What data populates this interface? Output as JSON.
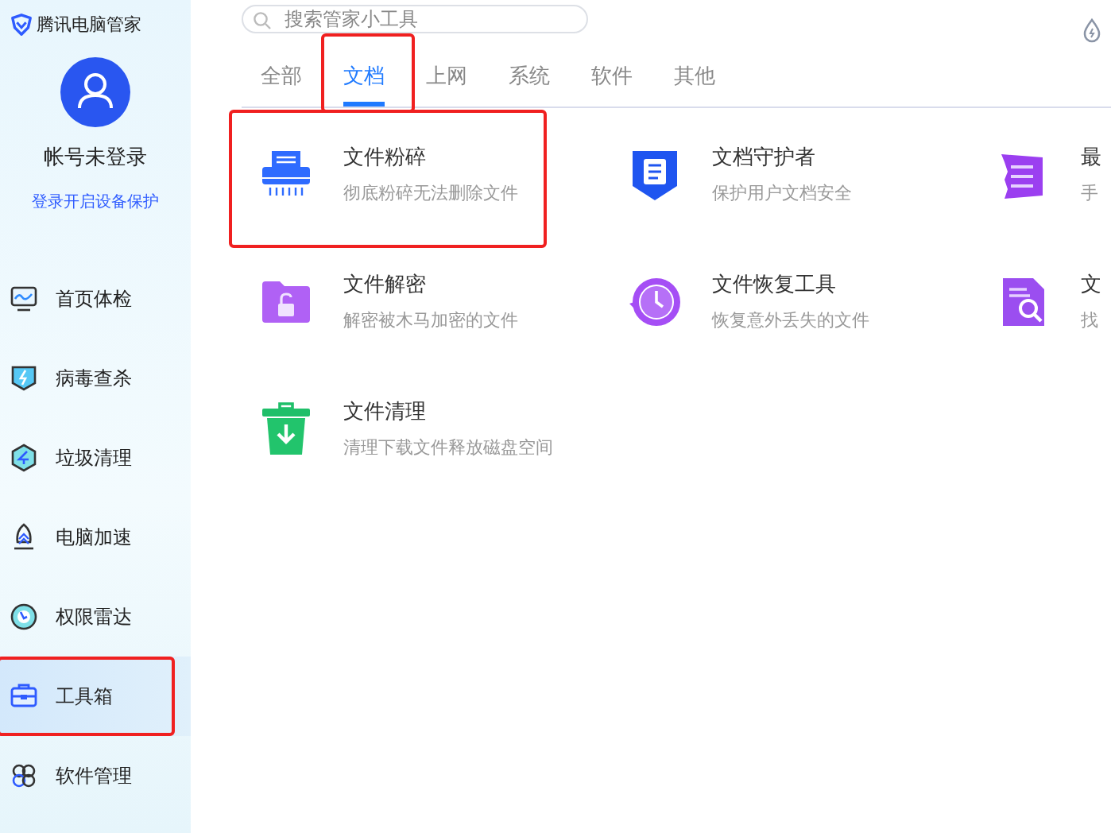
{
  "app": {
    "title": "腾讯电脑管家"
  },
  "account": {
    "name": "帐号未登录",
    "link": "登录开启设备保护"
  },
  "nav": [
    {
      "label": "首页体检",
      "selected": false,
      "highlighted": false
    },
    {
      "label": "病毒查杀",
      "selected": false,
      "highlighted": false
    },
    {
      "label": "垃圾清理",
      "selected": false,
      "highlighted": false
    },
    {
      "label": "电脑加速",
      "selected": false,
      "highlighted": false
    },
    {
      "label": "权限雷达",
      "selected": false,
      "highlighted": false
    },
    {
      "label": "工具箱",
      "selected": true,
      "highlighted": true
    },
    {
      "label": "软件管理",
      "selected": false,
      "highlighted": false
    }
  ],
  "search": {
    "placeholder": "搜索管家小工具"
  },
  "tabs": [
    {
      "label": "全部",
      "selected": false,
      "highlighted": false
    },
    {
      "label": "文档",
      "selected": true,
      "highlighted": true
    },
    {
      "label": "上网",
      "selected": false,
      "highlighted": false
    },
    {
      "label": "系统",
      "selected": false,
      "highlighted": false
    },
    {
      "label": "软件",
      "selected": false,
      "highlighted": false
    },
    {
      "label": "其他",
      "selected": false,
      "highlighted": false
    }
  ],
  "tools": [
    {
      "title": "文件粉碎",
      "desc": "彻底粉碎无法删除文件",
      "highlighted": true
    },
    {
      "title": "文档守护者",
      "desc": "保护用户文档安全",
      "highlighted": false
    },
    {
      "title": "最",
      "desc": "手",
      "highlighted": false
    },
    {
      "title": "文件解密",
      "desc": "解密被木马加密的文件",
      "highlighted": false
    },
    {
      "title": "文件恢复工具",
      "desc": "恢复意外丢失的文件",
      "highlighted": false
    },
    {
      "title": "文",
      "desc": "找",
      "highlighted": false
    },
    {
      "title": "文件清理",
      "desc": "清理下载文件释放磁盘空间",
      "highlighted": false
    }
  ]
}
